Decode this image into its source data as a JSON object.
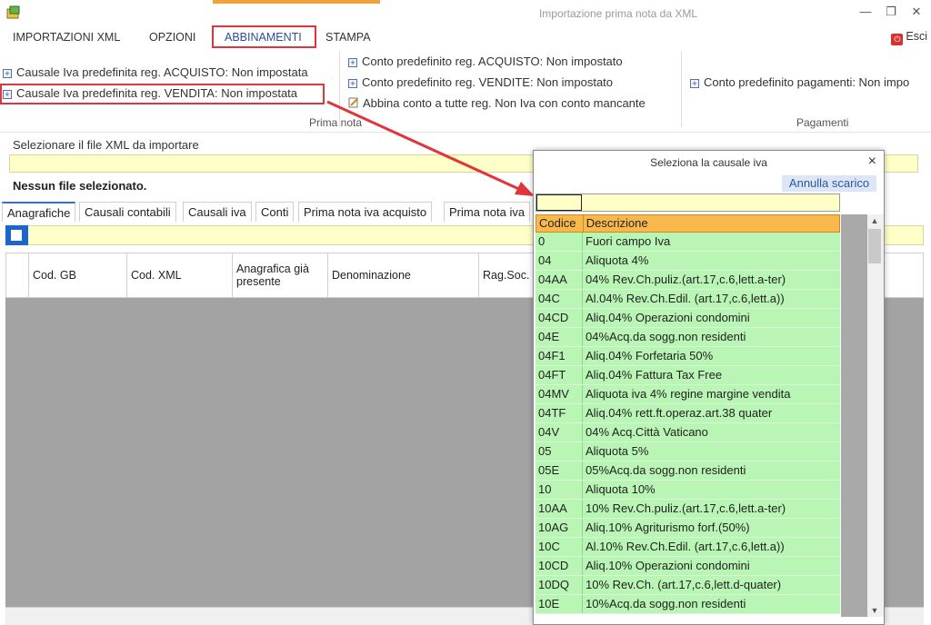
{
  "window": {
    "title": "Importazione prima nota da XML"
  },
  "menu": {
    "items": [
      "IMPORTAZIONI XML",
      "OPZIONI",
      "ABBINAMENTI",
      "STAMPA"
    ],
    "active": "ABBINAMENTI",
    "exit_label": "Esci"
  },
  "ribbon": {
    "prima_nota": {
      "col1": [
        "Causale Iva predefinita reg. ACQUISTO: Non impostata",
        "Causale Iva predefinita reg. VENDITA: Non impostata"
      ],
      "col2": [
        "Conto predefinito reg. ACQUISTO: Non impostato",
        "Conto predefinito reg. VENDITE: Non impostato",
        "Abbina conto a tutte reg. Non Iva con conto mancante"
      ],
      "label": "Prima nota"
    },
    "pagamenti": {
      "item": "Conto predefinito pagamenti: Non impo",
      "label": "Pagamenti"
    }
  },
  "file": {
    "label": "Selezionare il file XML da importare",
    "value": "",
    "status": "Nessun file selezionato."
  },
  "tabs": [
    "Anagrafiche",
    "Causali contabili",
    "Causali iva",
    "Conti",
    "Prima nota iva acquisto",
    "Prima nota iva"
  ],
  "active_tab": "Anagrafiche",
  "grid": {
    "columns": [
      "Cod. GB",
      "Cod. XML",
      "Anagrafica già presente",
      "Denominazione",
      "Rag.Soc."
    ]
  },
  "popup": {
    "title": "Seleziona la causale iva",
    "close": "×",
    "annulla": "Annulla scarico",
    "columns": [
      "Codice",
      "Descrizione"
    ],
    "rows": [
      [
        "0",
        "Fuori campo Iva"
      ],
      [
        "04",
        "Aliquota 4%"
      ],
      [
        "04AA",
        "04% Rev.Ch.puliz.(art.17,c.6,lett.a-ter)"
      ],
      [
        "04C",
        "Al.04% Rev.Ch.Edil. (art.17,c.6,lett.a))"
      ],
      [
        "04CD",
        "Aliq.04% Operazioni condomini"
      ],
      [
        "04E",
        "04%Acq.da sogg.non residenti"
      ],
      [
        "04F1",
        "Aliq.04% Forfetaria 50%"
      ],
      [
        "04FT",
        "Aliq.04% Fattura Tax Free"
      ],
      [
        "04MV",
        "Aliquota iva 4% regine margine vendita"
      ],
      [
        "04TF",
        "Aliq.04% rett.ft.operaz.art.38 quater"
      ],
      [
        "04V",
        "04% Acq.Città Vaticano"
      ],
      [
        "05",
        "Aliquota 5%"
      ],
      [
        "05E",
        "05%Acq.da sogg.non residenti"
      ],
      [
        "10",
        "Aliquota 10%"
      ],
      [
        "10AA",
        "10% Rev.Ch.puliz.(art.17,c.6,lett.a-ter)"
      ],
      [
        "10AG",
        "Aliq.10% Agriturismo forf.(50%)"
      ],
      [
        "10C",
        "Al.10% Rev.Ch.Edil. (art.17,c.6,lett.a))"
      ],
      [
        "10CD",
        "Aliq.10% Operazioni condomini"
      ],
      [
        "10DQ",
        "10% Rev.Ch. (art.17,c.6,lett.d-quater)"
      ],
      [
        "10E",
        "10%Acq.da sogg.non residenti"
      ]
    ]
  },
  "colors": {
    "highlight": "#e0353b",
    "row_green": "#b9f5b4",
    "header_orange": "#f7b94d",
    "input_yellow": "#ffffc8"
  }
}
